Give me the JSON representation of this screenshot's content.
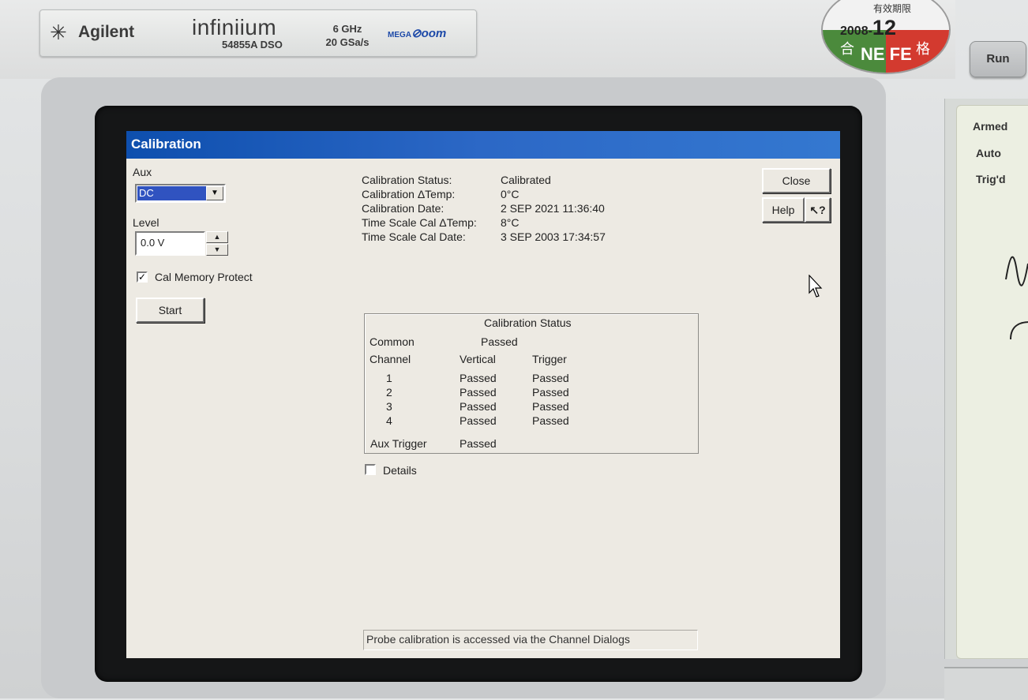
{
  "hardware": {
    "brand": "Agilent",
    "brand_logo_glyph": "✳",
    "model_name": "infiniium",
    "model_number": "54855A DSO",
    "spec_bandwidth": "6 GHz",
    "spec_sample_rate": "20 GSa/s",
    "megazoom_prefix": "MEGA",
    "megazoom_suffix": "oom",
    "sticker": {
      "label": "有效期限",
      "year": "2008-",
      "month": "12",
      "left_char": "合",
      "mark": "NE FE",
      "right_char": "格"
    },
    "run_button": "Run",
    "status_indicators": [
      "Armed",
      "Auto",
      "Trig'd"
    ]
  },
  "dialog": {
    "title": "Calibration",
    "aux": {
      "label": "Aux",
      "selected": "DC",
      "dropdown_arrow": "▼"
    },
    "level": {
      "label": "Level",
      "value": "0.0 V",
      "spin_up": "▲",
      "spin_down": "▼"
    },
    "cal_memory_protect": {
      "label": "Cal Memory Protect",
      "check_mark": "✓"
    },
    "start_button": "Start",
    "close_button": "Close",
    "help_button": "Help",
    "context_help_button": "↖?",
    "status_info": [
      {
        "label": "Calibration Status:",
        "value": "Calibrated"
      },
      {
        "label": "Calibration ΔTemp:",
        "value": "0°C"
      },
      {
        "label": "Calibration Date:",
        "value": "2 SEP 2021 11:36:40"
      },
      {
        "label": "Time Scale Cal ΔTemp:",
        "value": "8°C"
      },
      {
        "label": "Time Scale Cal Date:",
        "value": "3 SEP 2003 17:34:57"
      }
    ],
    "status_group": {
      "title": "Calibration Status",
      "common_label": "Common",
      "common_value": "Passed",
      "headers": [
        "Channel",
        "Vertical",
        "Trigger"
      ],
      "channels": [
        {
          "channel": "1",
          "vertical": "Passed",
          "trigger": "Passed"
        },
        {
          "channel": "2",
          "vertical": "Passed",
          "trigger": "Passed"
        },
        {
          "channel": "3",
          "vertical": "Passed",
          "trigger": "Passed"
        },
        {
          "channel": "4",
          "vertical": "Passed",
          "trigger": "Passed"
        }
      ],
      "aux_trigger_label": "Aux Trigger",
      "aux_trigger_value": "Passed"
    },
    "details_label": "Details",
    "footer_hint": "Probe calibration is accessed via the Channel Dialogs"
  }
}
